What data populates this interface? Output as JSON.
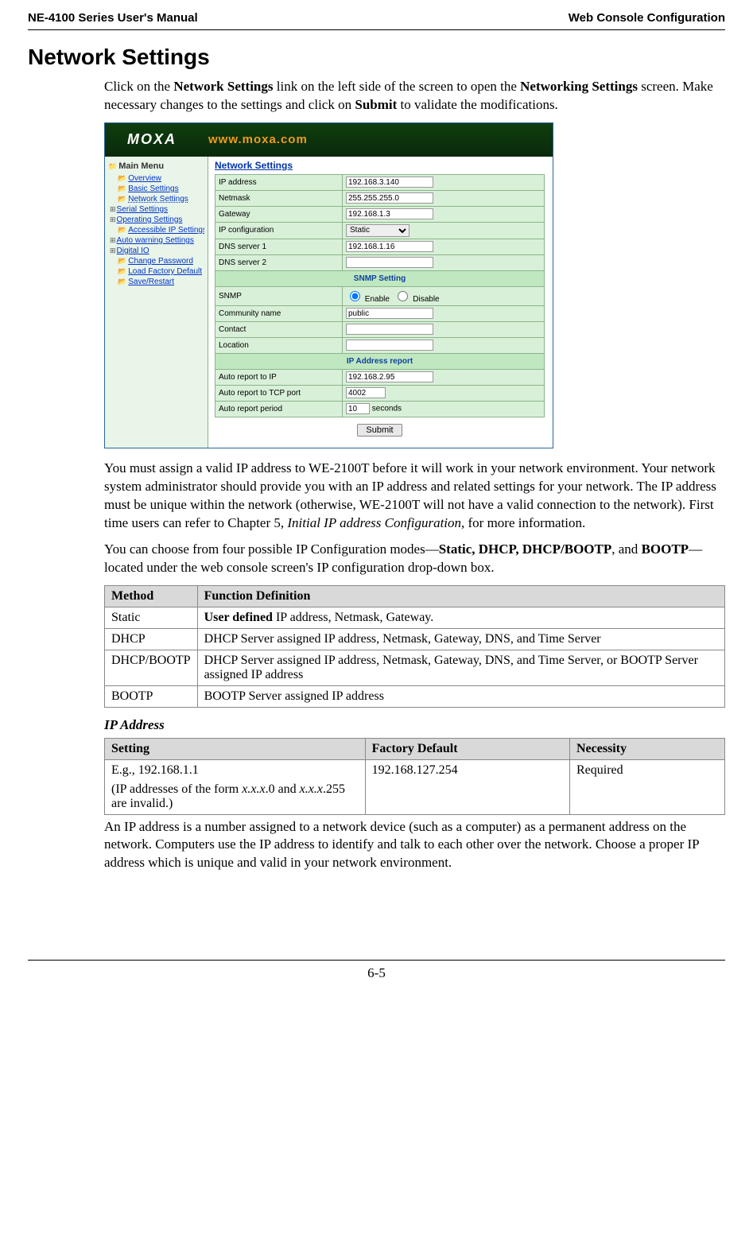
{
  "header": {
    "left": "NE-4100 Series User's Manual",
    "right": "Web Console Configuration"
  },
  "section_title": "Network Settings",
  "intro1_a": "Click on the ",
  "intro1_b": "Network Settings",
  "intro1_c": " link on the left side of the screen to open the ",
  "intro1_d": "Networking Settings",
  "intro1_e": " screen. Make necessary changes to the settings and click on ",
  "intro1_f": "Submit",
  "intro1_g": " to validate the modifications.",
  "shot": {
    "logo": "MOXA",
    "url": "www.moxa.com",
    "main_menu": "Main Menu",
    "nav": [
      "Overview",
      "Basic Settings",
      "Network Settings",
      "Serial Settings",
      "Operating Settings",
      "Accessible IP Settings",
      "Auto warning Settings",
      "Digital IO",
      "Change Password",
      "Load Factory Default",
      "Save/Restart"
    ],
    "title": "Network Settings",
    "rows": [
      {
        "lbl": "IP address",
        "val": "192.168.3.140",
        "type": "text"
      },
      {
        "lbl": "Netmask",
        "val": "255.255.255.0",
        "type": "text"
      },
      {
        "lbl": "Gateway",
        "val": "192.168.1.3",
        "type": "text"
      },
      {
        "lbl": "IP configuration",
        "val": "Static",
        "type": "select"
      },
      {
        "lbl": "DNS server 1",
        "val": "192.168.1.16",
        "type": "text"
      },
      {
        "lbl": "DNS server 2",
        "val": "",
        "type": "text"
      }
    ],
    "snmp_hdr": "SNMP Setting",
    "snmp_rows": [
      {
        "lbl": "SNMP",
        "type": "radio",
        "opt1": "Enable",
        "opt2": "Disable"
      },
      {
        "lbl": "Community name",
        "val": "public",
        "type": "text"
      },
      {
        "lbl": "Contact",
        "val": "",
        "type": "text"
      },
      {
        "lbl": "Location",
        "val": "",
        "type": "text"
      }
    ],
    "ipr_hdr": "IP Address report",
    "ipr_rows": [
      {
        "lbl": "Auto report to IP",
        "val": "192.168.2.95",
        "type": "text"
      },
      {
        "lbl": "Auto report to TCP port",
        "val": "4002",
        "type": "text"
      },
      {
        "lbl": "Auto report period",
        "val": "10",
        "suffix": "seconds",
        "type": "text_small"
      }
    ],
    "submit": "Submit"
  },
  "para2_a": "You must assign a valid IP address to WE-2100T before it will work in your network environment. Your network system administrator should provide you with an IP address and related settings for your network. The IP address must be unique within the network (otherwise, WE-2100T will not have a valid connection to the network). First time users can refer to Chapter 5, ",
  "para2_b": "Initial IP address Configuration",
  "para2_c": ", for more information.",
  "para3_a": "You can choose from four possible IP Configuration modes—",
  "para3_b": "Static, DHCP, DHCP/BOOTP",
  "para3_c": ", and ",
  "para3_d": "BOOTP",
  "para3_e": "—located under the web console screen's IP configuration drop-down box.",
  "methods_table": {
    "headers": [
      "Method",
      "Function Definition"
    ],
    "rows": [
      {
        "m": "Static",
        "d_pre": "User defined",
        "d_post": " IP address, Netmask, Gateway."
      },
      {
        "m": "DHCP",
        "d": "DHCP Server assigned IP address, Netmask, Gateway, DNS, and Time Server"
      },
      {
        "m": "DHCP/BOOTP",
        "d": "DHCP Server assigned IP address, Netmask, Gateway, DNS, and Time Server, or BOOTP Server assigned IP address"
      },
      {
        "m": "BOOTP",
        "d": "BOOTP Server assigned IP address"
      }
    ]
  },
  "ip_heading": "IP Address",
  "ip_table": {
    "headers": [
      "Setting",
      "Factory Default",
      "Necessity"
    ],
    "setting_line1": "E.g., 192.168.1.1",
    "setting_line2a": "(IP addresses of the form ",
    "setting_line2b": "x.x.x",
    "setting_line2c": ".0 and ",
    "setting_line2d": "x.x.x",
    "setting_line2e": ".255 are invalid.)",
    "default": "192.168.127.254",
    "necessity": "Required"
  },
  "para4": "An IP address is a number assigned to a network device (such as a computer) as a permanent address on the network. Computers use the IP address to identify and talk to each other over the network. Choose a proper IP address which is unique and valid in your network environment.",
  "footer": "6-5"
}
